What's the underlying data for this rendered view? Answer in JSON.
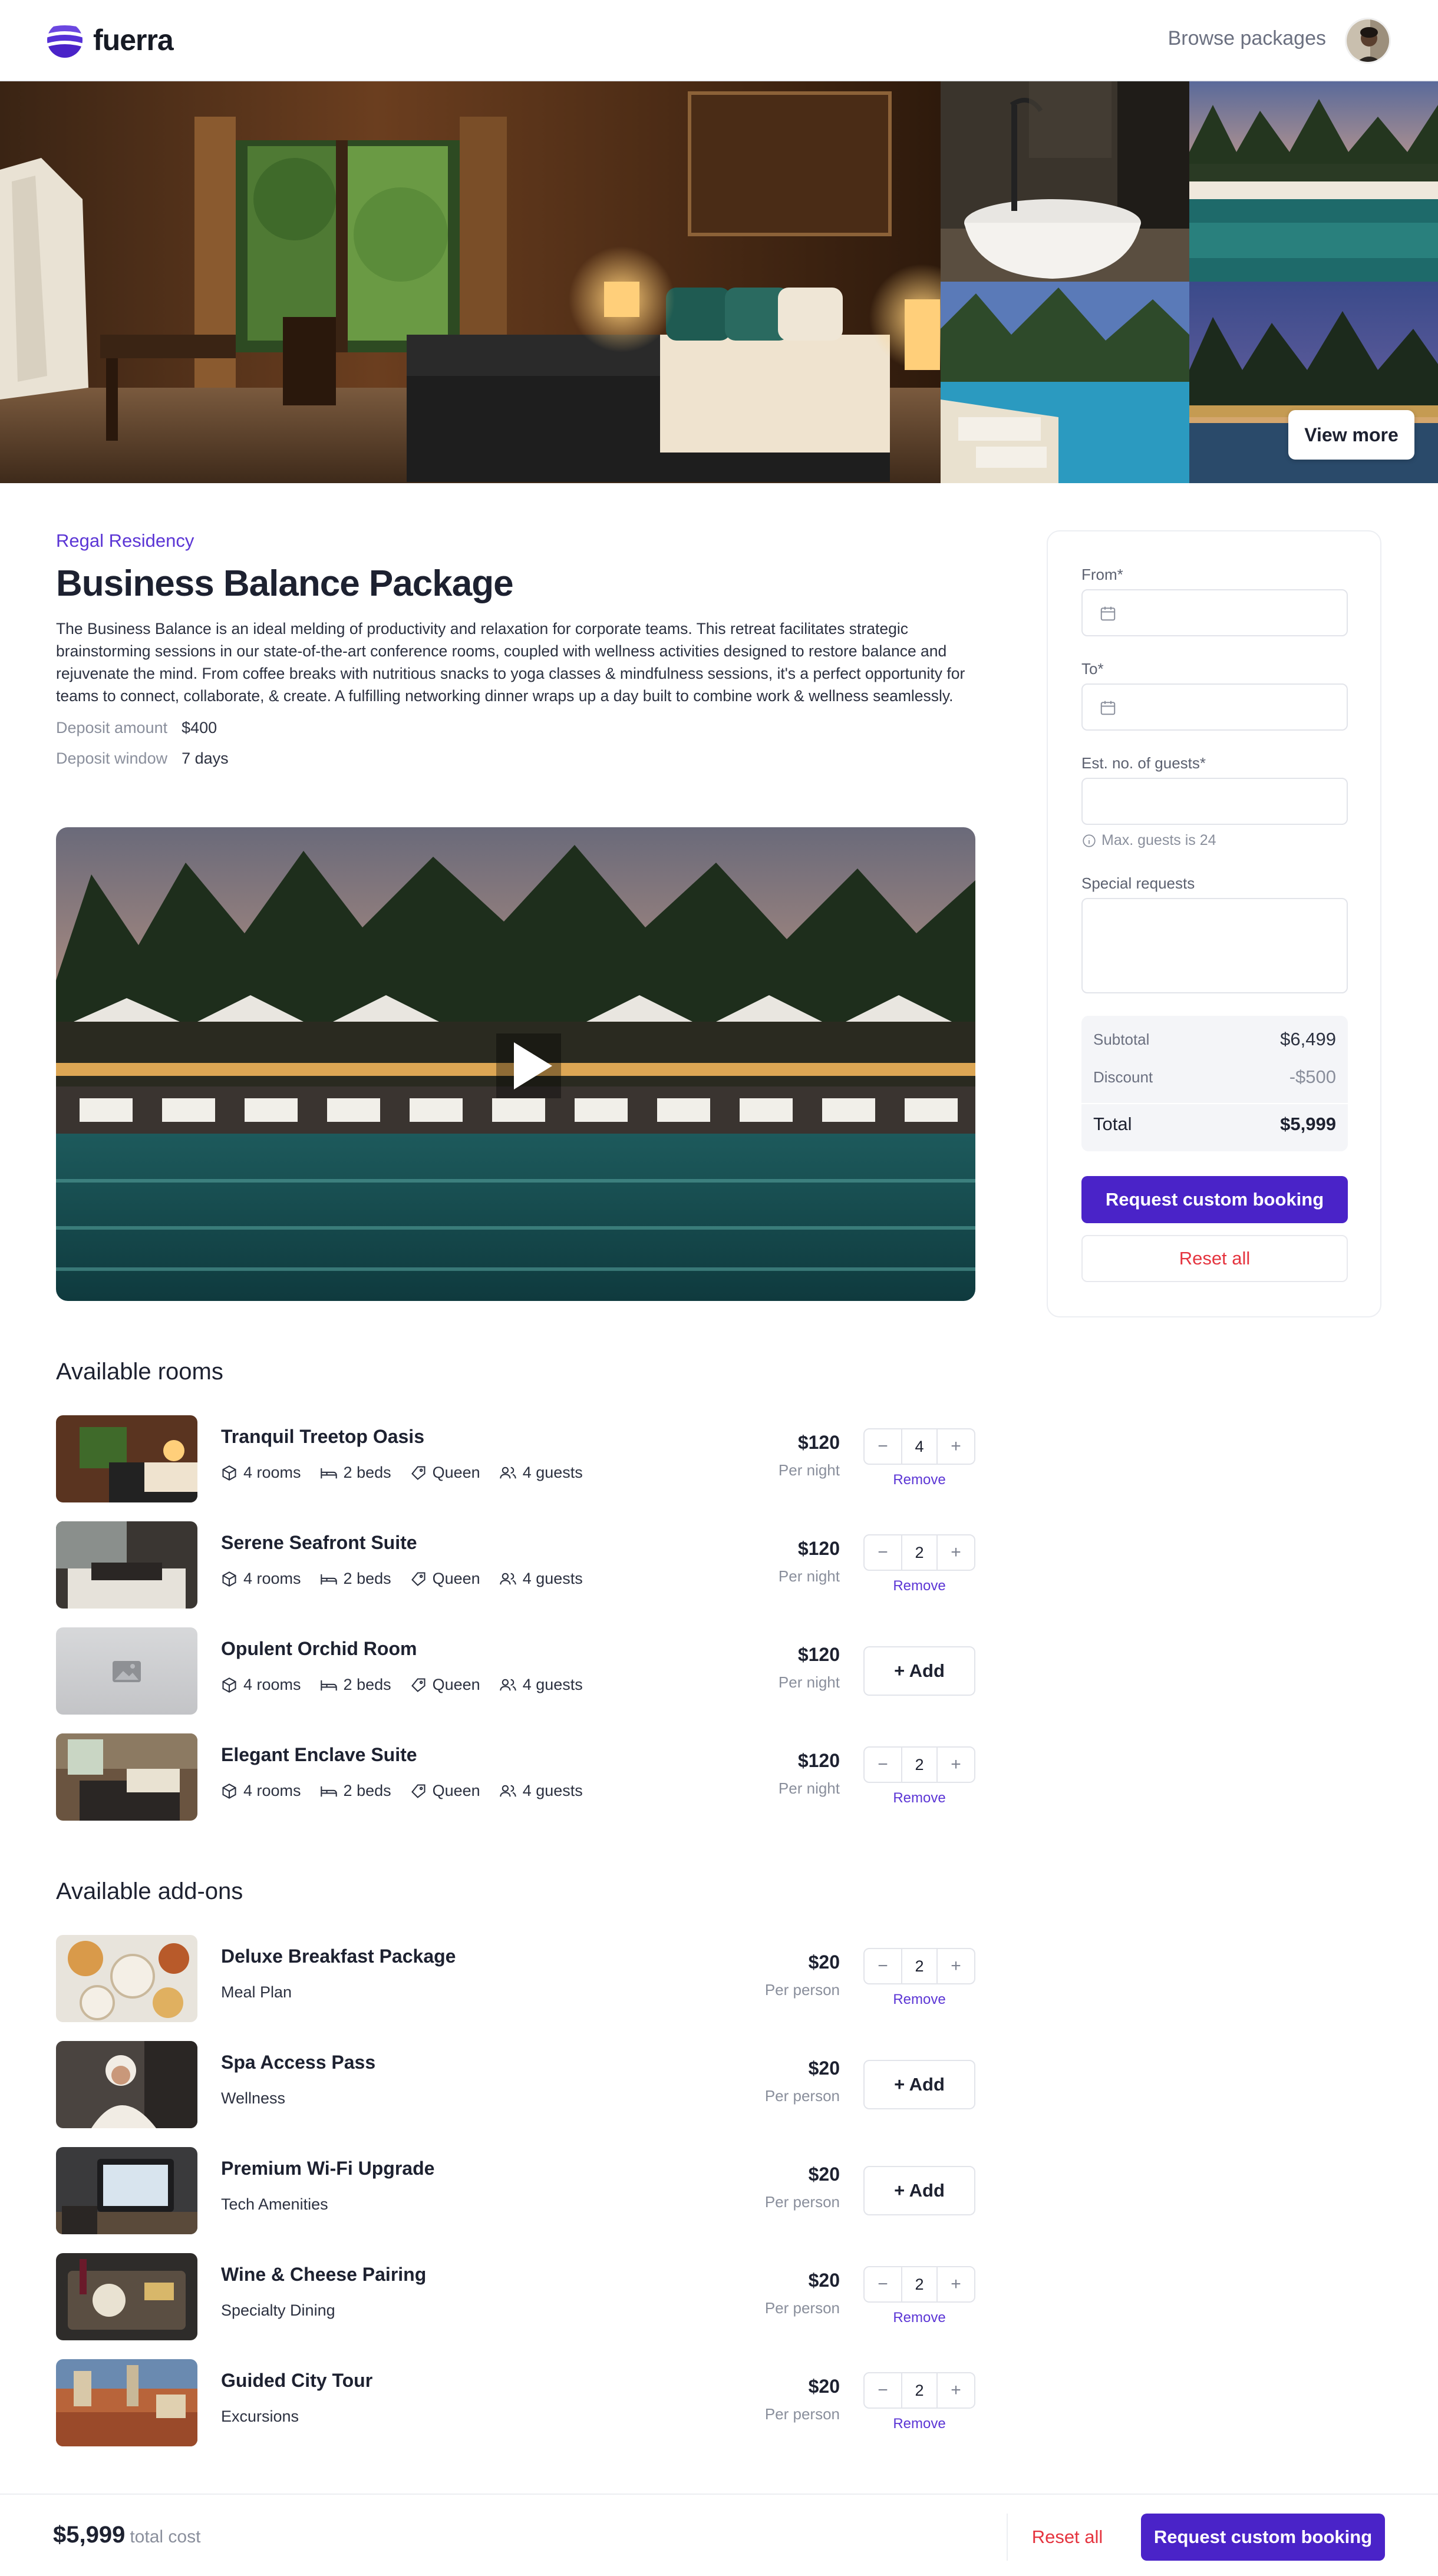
{
  "brand": {
    "name": "fuerra",
    "accent": "#4a23c8"
  },
  "nav": {
    "browse_label": "Browse packages"
  },
  "gallery": {
    "view_more_label": "View more"
  },
  "package": {
    "venue": "Regal Residency",
    "title": "Business Balance Package",
    "description": "The Business Balance is an ideal melding of productivity and relaxation for corporate teams. This retreat facilitates strategic brainstorming sessions in our state-of-the-art conference rooms, coupled with wellness activities designed to restore balance and rejuvenate the mind. From coffee breaks with nutritious snacks to yoga classes & mindfulness sessions, it's a perfect opportunity for teams to connect, collaborate, & create. A fulfilling networking dinner wraps up a day built to combine work & wellness seamlessly.",
    "deposit_amount_label": "Deposit amount",
    "deposit_amount": "$400",
    "deposit_window_label": "Deposit window",
    "deposit_window": "7 days"
  },
  "rooms": {
    "title": "Available rooms",
    "items": [
      {
        "name": "Tranquil Treetop Oasis",
        "rooms": "4 rooms",
        "beds": "2 beds",
        "bed_type": "Queen",
        "guests": "4 guests",
        "price": "$120",
        "unit": "Per night",
        "quantity": "4",
        "remove": "Remove",
        "added": true
      },
      {
        "name": "Serene Seafront Suite",
        "rooms": "4 rooms",
        "beds": "2 beds",
        "bed_type": "Queen",
        "guests": "4 guests",
        "price": "$120",
        "unit": "Per night",
        "quantity": "2",
        "remove": "Remove",
        "added": true
      },
      {
        "name": "Opulent Orchid Room",
        "rooms": "4 rooms",
        "beds": "2 beds",
        "bed_type": "Queen",
        "guests": "4 guests",
        "price": "$120",
        "unit": "Per night",
        "add_label": "+ Add",
        "added": false
      },
      {
        "name": "Elegant Enclave Suite",
        "rooms": "4 rooms",
        "beds": "2 beds",
        "bed_type": "Queen",
        "guests": "4 guests",
        "price": "$120",
        "unit": "Per night",
        "quantity": "2",
        "remove": "Remove",
        "added": true
      }
    ]
  },
  "addons": {
    "title": "Available add-ons",
    "items": [
      {
        "name": "Deluxe Breakfast Package",
        "category": "Meal Plan",
        "price": "$20",
        "unit": "Per person",
        "quantity": "2",
        "remove": "Remove",
        "added": true
      },
      {
        "name": "Spa Access Pass",
        "category": "Wellness",
        "price": "$20",
        "unit": "Per person",
        "add_label": "+ Add",
        "added": false
      },
      {
        "name": "Premium Wi-Fi Upgrade",
        "category": "Tech Amenities",
        "price": "$20",
        "unit": "Per person",
        "add_label": "+ Add",
        "added": false
      },
      {
        "name": "Wine & Cheese Pairing",
        "category": "Specialty Dining",
        "price": "$20",
        "unit": "Per person",
        "quantity": "2",
        "remove": "Remove",
        "added": true
      },
      {
        "name": "Guided City Tour",
        "category": "Excursions",
        "price": "$20",
        "unit": "Per person",
        "quantity": "2",
        "remove": "Remove",
        "added": true
      }
    ]
  },
  "booking": {
    "from_label": "From*",
    "to_label": "To*",
    "guests_label": "Est. no. of guests*",
    "guests_hint": "Max. guests is 24",
    "requests_label": "Special requests",
    "subtotal_label": "Subtotal",
    "subtotal": "$6,499",
    "discount_label": "Discount",
    "discount": "-$500",
    "total_label": "Total",
    "total": "$5,999",
    "request_label": "Request custom booking",
    "reset_label": "Reset all"
  },
  "footer": {
    "total": "$5,999",
    "total_sub": "total cost",
    "reset_label": "Reset all",
    "request_label": "Request custom booking"
  },
  "icons": [
    "logo-mark-icon",
    "calendar-icon",
    "info-icon",
    "play-icon",
    "box-icon",
    "bed-icon",
    "tag-icon",
    "users-icon",
    "minus-icon",
    "plus-icon",
    "image-placeholder-icon"
  ]
}
